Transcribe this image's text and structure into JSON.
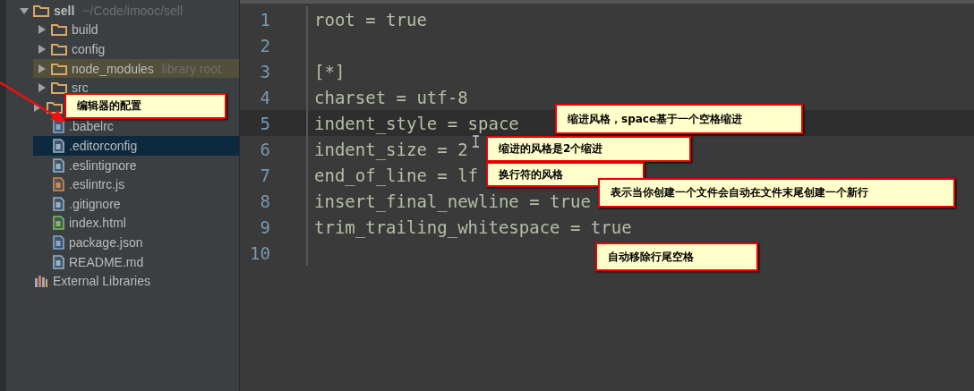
{
  "project_tree": {
    "root": {
      "label": "sell",
      "path": "~/Code/imooc/sell",
      "expanded": true,
      "selected": false,
      "children": [
        {
          "kind": "folder",
          "label": "build",
          "expanded": false,
          "selected": false
        },
        {
          "kind": "folder",
          "label": "config",
          "expanded": false,
          "selected": false
        },
        {
          "kind": "folder",
          "label": "node_modules",
          "hint": "library root",
          "expanded": false,
          "selected": false,
          "highlighted": true
        },
        {
          "kind": "folder",
          "label": "src",
          "expanded": false,
          "selected": false
        },
        {
          "kind": "folder",
          "expanded": false
        },
        {
          "kind": "json-file",
          "label": ".babelrc",
          "selected": false
        },
        {
          "kind": "text-file",
          "label": ".editorconfig",
          "selected": true
        },
        {
          "kind": "text-file",
          "label": ".eslintignore",
          "selected": false
        },
        {
          "kind": "js-file",
          "label": ".eslintrc.js",
          "selected": false
        },
        {
          "kind": "text-file",
          "label": ".gitignore",
          "selected": false
        },
        {
          "kind": "html-file",
          "label": "index.html",
          "selected": false
        },
        {
          "kind": "json-file",
          "label": "package.json",
          "selected": false
        },
        {
          "kind": "text-file",
          "label": "README.md",
          "selected": false
        }
      ]
    },
    "external": {
      "label": "External Libraries"
    }
  },
  "editor": {
    "lines": [
      {
        "number": "1",
        "text": "root = true",
        "current": false
      },
      {
        "number": "2",
        "current": false
      },
      {
        "number": "3",
        "text": "[*]",
        "current": false
      },
      {
        "number": "4",
        "text": "charset = utf-8",
        "current": false
      },
      {
        "number": "5",
        "text": "indent_style = space",
        "current": true
      },
      {
        "number": "6",
        "text": "indent_size = 2",
        "current": false
      },
      {
        "number": "7",
        "text": "end_of_line = lf",
        "current": false
      },
      {
        "number": "8",
        "text": "insert_final_newline = true",
        "current": false
      },
      {
        "number": "9",
        "text": "trim_trailing_whitespace = true",
        "current": false
      },
      {
        "number": "10",
        "current": false
      }
    ]
  },
  "annotations": [
    {
      "text": "编辑器的配置"
    },
    {
      "text": "缩进风格，space基于一个空格缩进"
    },
    {
      "text": "缩进的风格是2个缩进"
    },
    {
      "text": "换行符的风格"
    },
    {
      "text": "表示当你创建一个文件会自动在文件末尾创建一个新行"
    },
    {
      "text": "自动移除行尾空格"
    }
  ]
}
